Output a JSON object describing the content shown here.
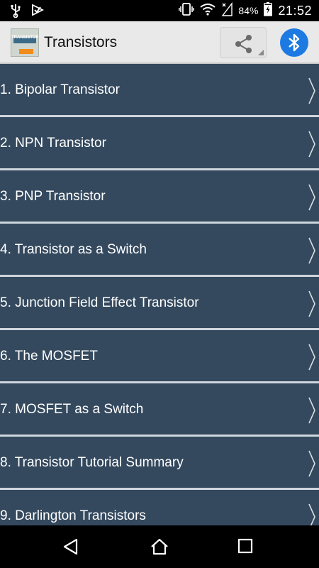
{
  "status_bar": {
    "battery_percent": "84%",
    "time": "21:52",
    "icons": [
      "usb-icon",
      "download-check-icon",
      "vibrate-icon",
      "wifi-icon",
      "no-signal-icon",
      "battery-charging-icon"
    ]
  },
  "app_bar": {
    "title": "Transistors",
    "logo_text": "TRANSISTORS",
    "share_icon": "share-icon",
    "bluetooth_icon": "bluetooth-icon"
  },
  "list": {
    "items": [
      {
        "label": "1. Bipolar Transistor"
      },
      {
        "label": "2. NPN Transistor"
      },
      {
        "label": "3. PNP Transistor"
      },
      {
        "label": "4. Transistor as a Switch"
      },
      {
        "label": "5. Junction Field Effect Transistor"
      },
      {
        "label": "6. The MOSFET"
      },
      {
        "label": "7. MOSFET as a Switch"
      },
      {
        "label": "8. Transistor Tutorial Summary"
      },
      {
        "label": "9. Darlington Transistors"
      }
    ]
  },
  "nav_bar": {
    "buttons": [
      "back-icon",
      "home-icon",
      "recents-icon"
    ]
  },
  "colors": {
    "list_item_bg": "#34495e",
    "list_separator": "#cfd5dc",
    "bluetooth_accent": "#1c7ae2",
    "app_bar_bg": "#e9e9e9"
  }
}
